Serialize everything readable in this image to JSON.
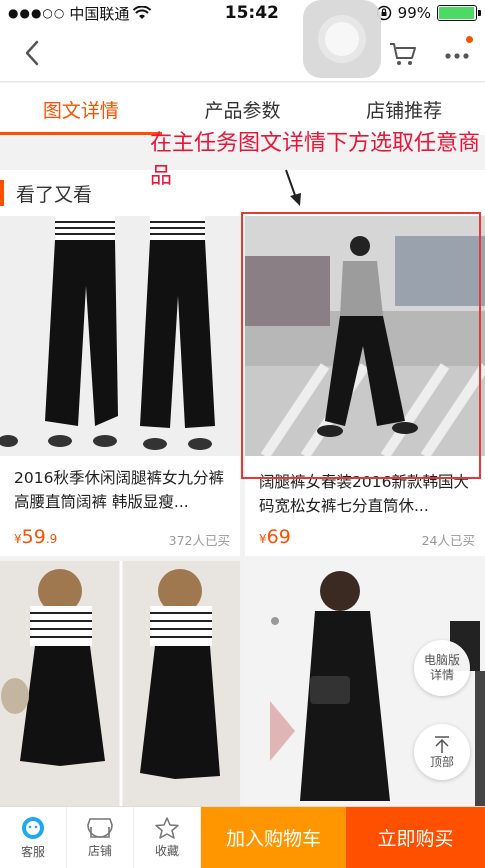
{
  "status_bar": {
    "carrier": "中国联通",
    "time": "15:42",
    "battery": "99%"
  },
  "tabs": [
    {
      "label": "图文详情"
    },
    {
      "label": "产品参数"
    },
    {
      "label": "店铺推荐"
    }
  ],
  "annotation": {
    "text": "在主任务图文详情下方选取任意商品"
  },
  "section": {
    "title": "看了又看"
  },
  "products": [
    {
      "title": "2016秋季休闲阔腿裤女九分裤 高腰直筒阔裤 韩版显瘦...",
      "price_symbol": "¥",
      "price_int": "59",
      "price_dec": ".9",
      "sold": "372人已买"
    },
    {
      "title": "阔腿裤女春装2016新款韩国大码宽松女裤七分直筒休...",
      "price_symbol": "¥",
      "price_int": "69",
      "price_dec": "",
      "sold": "24人已买"
    },
    {
      "title": "",
      "price_symbol": "",
      "price_int": "",
      "price_dec": "",
      "sold": ""
    },
    {
      "title": "",
      "price_symbol": "",
      "price_int": "",
      "price_dec": "",
      "sold": ""
    }
  ],
  "floating": {
    "pc_version": "电脑版\n详情",
    "top": "顶部"
  },
  "bottom_bar": {
    "service": "客服",
    "store": "店铺",
    "favorite": "收藏",
    "add_cart": "加入购物车",
    "buy_now": "立即购买"
  },
  "colors": {
    "accent": "#ff5000",
    "cart_button": "#ff9600",
    "annotation": "#e8163a"
  }
}
